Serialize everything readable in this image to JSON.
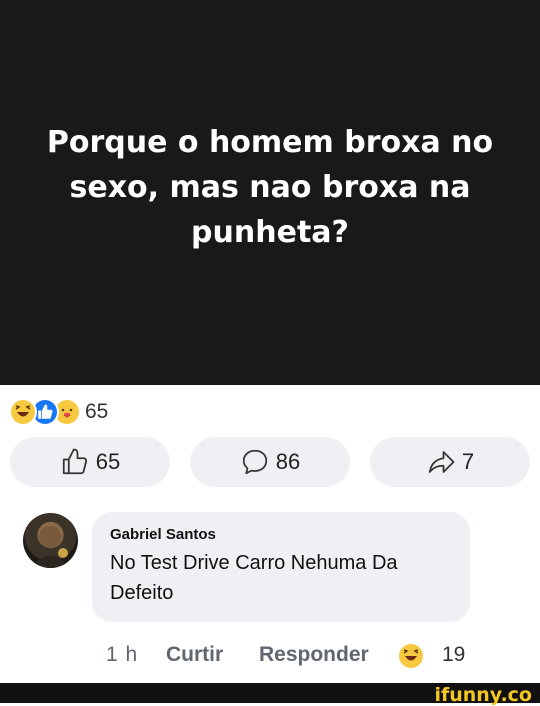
{
  "post": {
    "text": "Porque o homem broxa no sexo, mas nao broxa na punheta?"
  },
  "reactions": {
    "count": "65",
    "types": [
      "haha",
      "like",
      "care"
    ]
  },
  "actions": {
    "like_count": "65",
    "comment_count": "86",
    "share_count": "7"
  },
  "comment": {
    "author": "Gabriel Santos",
    "text": "No Test Drive Carro Nehuma Da Defeito",
    "time": "1 h",
    "like_label": "Curtir",
    "reply_label": "Responder",
    "reaction_count": "19"
  },
  "watermark": "ifunny.co",
  "colors": {
    "post_bg": "#191919",
    "bubble_bg": "#eef0f3",
    "like_blue": "#1877f2",
    "watermark": "#f3c623"
  }
}
